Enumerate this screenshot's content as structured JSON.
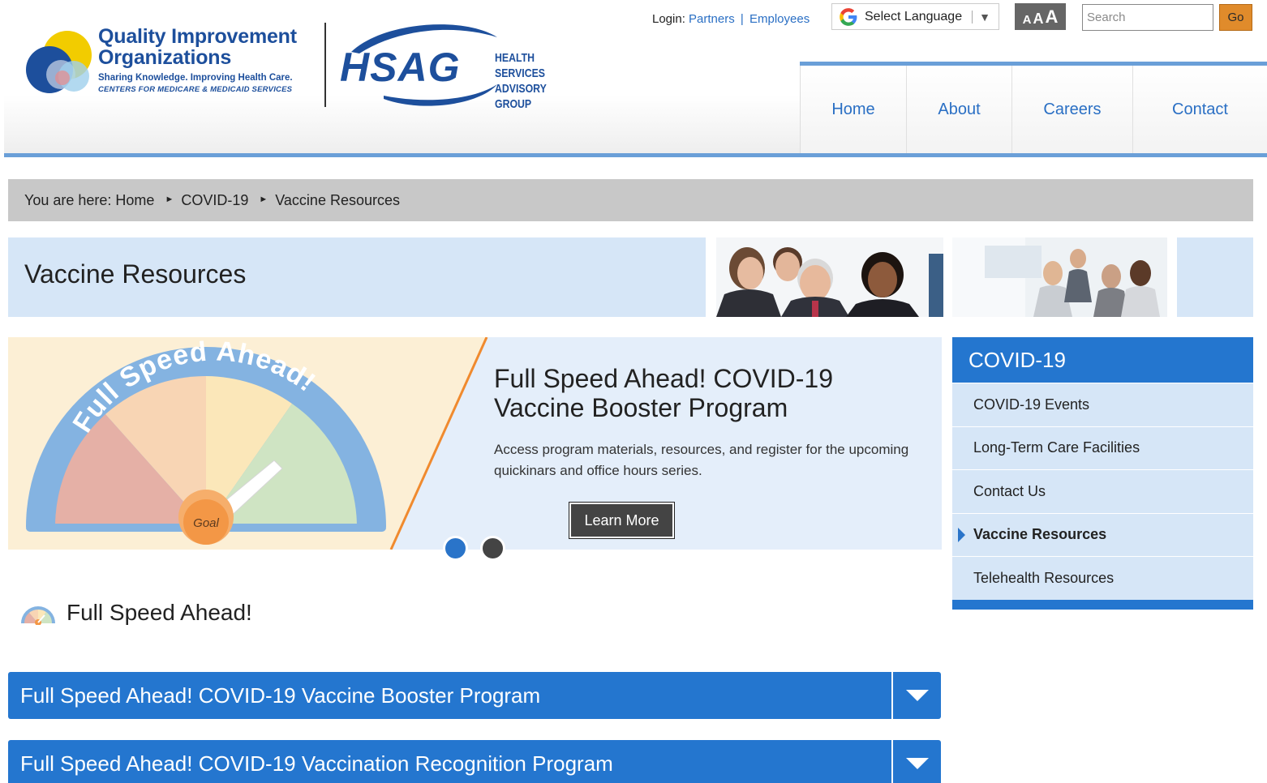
{
  "header": {
    "qio_logo": {
      "line1": "Quality Improvement",
      "line2": "Organizations",
      "tagline": "Sharing Knowledge. Improving Health Care.",
      "agency": "CENTERS FOR MEDICARE & MEDICAID SERVICES"
    },
    "hsag_logo": {
      "word": "HSAG",
      "sub1": "HEALTH SERVICES",
      "sub2": "ADVISORY GROUP"
    },
    "login": {
      "label": "Login:",
      "partners": "Partners",
      "separator": "|",
      "employees": "Employees"
    },
    "language": {
      "label": "Select Language",
      "arrow": "▼",
      "icon": "google-g-icon"
    },
    "text_size": {
      "small": "A",
      "medium": "A",
      "large": "A"
    },
    "search": {
      "placeholder": "Search",
      "button": "Go"
    },
    "nav": [
      "Home",
      "About",
      "Careers",
      "Contact"
    ]
  },
  "breadcrumb": {
    "prefix": "You are here:",
    "items": [
      "Home",
      "COVID-19",
      "Vaccine Resources"
    ],
    "separator": "►"
  },
  "page": {
    "title": "Vaccine Resources"
  },
  "slider": {
    "graphic_text": "Full Speed Ahead!",
    "gauge_label": "Goal",
    "title": "Full Speed Ahead! COVID-19 Vaccine Booster Program",
    "description": "Access program materials, resources, and register for the upcoming quickinars and office hours series.",
    "button": "Learn More",
    "slide_count": 2,
    "active_slide": 1
  },
  "sidebar": {
    "heading": "COVID-19",
    "items": [
      {
        "label": "COVID-19 Events"
      },
      {
        "label": "Long-Term Care Facilities"
      },
      {
        "label": "Contact Us"
      },
      {
        "label": "Vaccine Resources"
      },
      {
        "label": "Telehealth Resources"
      }
    ],
    "active_index": 3
  },
  "section": {
    "title": "Full Speed Ahead!",
    "accordions": [
      {
        "label": "Full Speed Ahead! COVID-19 Vaccine Booster Program"
      },
      {
        "label": "Full Speed Ahead! COVID-19 Vaccination Recognition Program"
      }
    ]
  },
  "colors": {
    "brand_blue": "#2476cf",
    "light_blue": "#d6e6f7",
    "link_blue": "#2a6fc4",
    "go_orange": "#e08b2b"
  }
}
